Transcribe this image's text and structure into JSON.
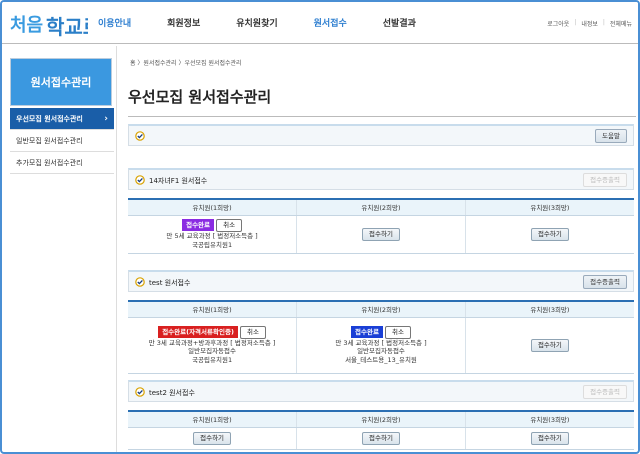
{
  "header": {
    "logo_text": "처음학교로",
    "nav": [
      "이용안내",
      "회원정보",
      "유치원찾기",
      "원서접수",
      "선발결과"
    ],
    "util": [
      "로그아웃",
      "내정보",
      "전체메뉴"
    ]
  },
  "sidebar": {
    "title": "원서접수관리",
    "items": [
      {
        "label": "우선모집 원서접수관리",
        "arrow": "›"
      },
      {
        "label": "일반모집 원서접수관리"
      },
      {
        "label": "추가모집 원서접수관리"
      }
    ]
  },
  "main": {
    "breadcrumb": "홈 〉원서접수관리 〉우선모집 원서접수관리",
    "title": "우선모집 원서접수관리",
    "help_label": "도움말",
    "columns": [
      "유치원(1희망)",
      "유치원(2희망)",
      "유치원(3희망)"
    ],
    "apply_label": "접수하기",
    "print_label": "접수증출력",
    "cancel_label": "취소",
    "sections": [
      {
        "name": "14자녀F1 원서접수",
        "print_disabled": true,
        "choice1": {
          "badge": "접수완료",
          "lines": [
            "만 5세 교육과정 [ 법정저소득층 ]",
            "국공립유치원1"
          ]
        }
      },
      {
        "name": "test 원서접수",
        "print_disabled": false,
        "choice1": {
          "badge": "접수완료(자격서류확인중)",
          "lines": [
            "만 3세 교육과정+방과후과정 [ 법정저소득층 ]",
            "일반모집자동접수",
            "국공립유치원1"
          ]
        },
        "choice2": {
          "badge": "접수완료",
          "lines": [
            "만 3세 교육과정 [ 법정저소득층 ]",
            "일반모집자동접수",
            "서울_테스트용_13_유치원"
          ]
        }
      },
      {
        "name": "test2 원서접수",
        "print_disabled": true
      }
    ]
  },
  "colors": {
    "accent": "#2f7fd0",
    "sidebar_title_bg": "#3b98e0",
    "sidebar_active_bg": "#1a5ea8",
    "badge_purple": "#8a2be2",
    "badge_red": "#d92020",
    "badge_blue": "#1a3fd6"
  }
}
